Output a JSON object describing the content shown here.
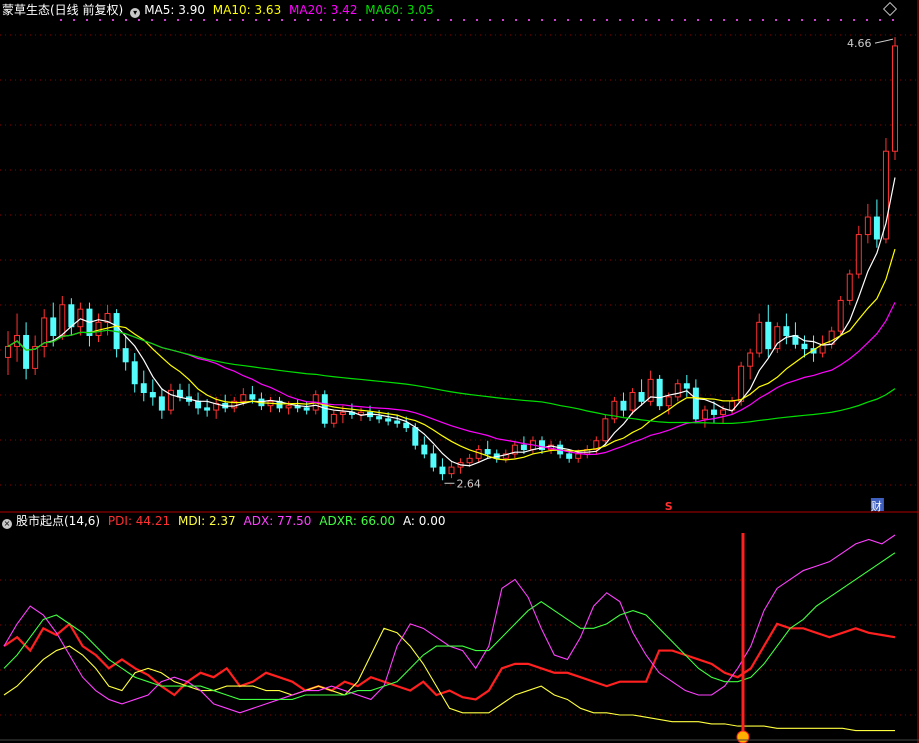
{
  "header": {
    "stock_title": "蒙草生态(日线 前复权)",
    "ma5": "MA5: 3.90",
    "ma10": "MA10: 3.63",
    "ma20": "MA20: 3.42",
    "ma60": "MA60: 3.05"
  },
  "indicator_header": {
    "title": "股市起点(14,6)",
    "pdi": "PDI: 44.21",
    "mdi": "MDI: 2.37",
    "adx": "ADX: 77.50",
    "adxr": "ADXR: 66.00",
    "a": "A: 0.00"
  },
  "colors": {
    "bg": "#000000",
    "up": "#ff3232",
    "down": "#54fcfc",
    "ma5": "#ffffff",
    "ma10": "#ffff00",
    "ma20": "#ff00ff",
    "ma60": "#00e000",
    "pdi": "#ff2020",
    "mdi": "#ffff40",
    "adx": "#ff40ff",
    "adxr": "#40ff40",
    "grid": "#8b0000",
    "frame": "#b00000"
  },
  "chart_data": [
    {
      "type": "candlestick",
      "title": "蒙草生态(日线 前复权)",
      "ylim": [
        2.55,
        4.72
      ],
      "annotations": {
        "high_label": "4.66",
        "low_label": "2.64",
        "marker_s": "S",
        "marker_cai": "财"
      },
      "ohlc": [
        [
          3.2,
          3.32,
          3.12,
          3.25
        ],
        [
          3.25,
          3.4,
          3.18,
          3.3
        ],
        [
          3.3,
          3.36,
          3.1,
          3.15
        ],
        [
          3.15,
          3.3,
          3.12,
          3.25
        ],
        [
          3.25,
          3.42,
          3.2,
          3.38
        ],
        [
          3.38,
          3.45,
          3.25,
          3.3
        ],
        [
          3.3,
          3.48,
          3.28,
          3.44
        ],
        [
          3.44,
          3.47,
          3.3,
          3.34
        ],
        [
          3.34,
          3.45,
          3.3,
          3.42
        ],
        [
          3.42,
          3.45,
          3.25,
          3.3
        ],
        [
          3.3,
          3.4,
          3.27,
          3.36
        ],
        [
          3.36,
          3.44,
          3.3,
          3.4
        ],
        [
          3.4,
          3.42,
          3.2,
          3.24
        ],
        [
          3.24,
          3.3,
          3.14,
          3.18
        ],
        [
          3.18,
          3.22,
          3.04,
          3.08
        ],
        [
          3.08,
          3.14,
          3.0,
          3.04
        ],
        [
          3.04,
          3.1,
          2.98,
          3.02
        ],
        [
          3.02,
          3.06,
          2.92,
          2.96
        ],
        [
          2.96,
          3.08,
          2.94,
          3.05
        ],
        [
          3.05,
          3.08,
          3.0,
          3.02
        ],
        [
          3.02,
          3.08,
          2.98,
          3.0
        ],
        [
          3.0,
          3.04,
          2.94,
          2.97
        ],
        [
          2.97,
          3.01,
          2.93,
          2.96
        ],
        [
          2.96,
          3.02,
          2.92,
          2.99
        ],
        [
          2.99,
          3.03,
          2.95,
          2.97
        ],
        [
          2.97,
          3.02,
          2.95,
          3.0
        ],
        [
          3.0,
          3.06,
          2.98,
          3.03
        ],
        [
          3.03,
          3.07,
          2.99,
          3.01
        ],
        [
          3.01,
          3.04,
          2.96,
          2.98
        ],
        [
          2.98,
          3.02,
          2.95,
          3.0
        ],
        [
          3.0,
          3.02,
          2.95,
          2.97
        ],
        [
          2.97,
          3.0,
          2.94,
          2.98
        ],
        [
          2.98,
          3.01,
          2.95,
          2.97
        ],
        [
          2.97,
          3.0,
          2.94,
          2.96
        ],
        [
          2.96,
          3.05,
          2.94,
          3.03
        ],
        [
          3.03,
          3.05,
          2.88,
          2.9
        ],
        [
          2.9,
          2.96,
          2.88,
          2.94
        ],
        [
          2.94,
          2.98,
          2.9,
          2.95
        ],
        [
          2.95,
          2.99,
          2.92,
          2.94
        ],
        [
          2.94,
          2.97,
          2.91,
          2.95
        ],
        [
          2.95,
          2.98,
          2.91,
          2.93
        ],
        [
          2.93,
          2.96,
          2.9,
          2.92
        ],
        [
          2.92,
          2.95,
          2.89,
          2.91
        ],
        [
          2.91,
          2.94,
          2.88,
          2.9
        ],
        [
          2.9,
          2.93,
          2.86,
          2.88
        ],
        [
          2.88,
          2.9,
          2.78,
          2.8
        ],
        [
          2.8,
          2.84,
          2.74,
          2.76
        ],
        [
          2.76,
          2.8,
          2.68,
          2.7
        ],
        [
          2.7,
          2.74,
          2.64,
          2.67
        ],
        [
          2.67,
          2.73,
          2.65,
          2.7
        ],
        [
          2.7,
          2.74,
          2.67,
          2.72
        ],
        [
          2.72,
          2.76,
          2.7,
          2.74
        ],
        [
          2.74,
          2.8,
          2.72,
          2.78
        ],
        [
          2.78,
          2.82,
          2.74,
          2.76
        ],
        [
          2.76,
          2.78,
          2.72,
          2.74
        ],
        [
          2.74,
          2.78,
          2.72,
          2.76
        ],
        [
          2.76,
          2.82,
          2.74,
          2.8
        ],
        [
          2.8,
          2.84,
          2.76,
          2.78
        ],
        [
          2.78,
          2.84,
          2.76,
          2.82
        ],
        [
          2.82,
          2.84,
          2.76,
          2.78
        ],
        [
          2.78,
          2.82,
          2.76,
          2.8
        ],
        [
          2.8,
          2.82,
          2.74,
          2.76
        ],
        [
          2.76,
          2.78,
          2.72,
          2.74
        ],
        [
          2.74,
          2.78,
          2.72,
          2.76
        ],
        [
          2.76,
          2.8,
          2.74,
          2.78
        ],
        [
          2.78,
          2.84,
          2.76,
          2.82
        ],
        [
          2.82,
          2.94,
          2.8,
          2.92
        ],
        [
          2.92,
          3.02,
          2.9,
          3.0
        ],
        [
          3.0,
          3.04,
          2.93,
          2.96
        ],
        [
          2.96,
          3.06,
          2.94,
          3.04
        ],
        [
          3.04,
          3.1,
          2.98,
          3.0
        ],
        [
          3.0,
          3.14,
          2.98,
          3.1
        ],
        [
          3.1,
          3.12,
          2.96,
          2.98
        ],
        [
          2.98,
          3.04,
          2.94,
          3.02
        ],
        [
          3.02,
          3.1,
          3.0,
          3.08
        ],
        [
          3.08,
          3.12,
          3.02,
          3.06
        ],
        [
          3.06,
          3.1,
          2.9,
          2.92
        ],
        [
          2.92,
          2.98,
          2.88,
          2.96
        ],
        [
          2.96,
          3.0,
          2.9,
          2.94
        ],
        [
          2.94,
          2.98,
          2.9,
          2.96
        ],
        [
          2.96,
          3.02,
          2.94,
          3.0
        ],
        [
          3.0,
          3.18,
          2.98,
          3.16
        ],
        [
          3.16,
          3.24,
          3.1,
          3.22
        ],
        [
          3.22,
          3.4,
          3.2,
          3.36
        ],
        [
          3.36,
          3.44,
          3.2,
          3.24
        ],
        [
          3.24,
          3.36,
          3.22,
          3.34
        ],
        [
          3.34,
          3.4,
          3.26,
          3.3
        ],
        [
          3.3,
          3.36,
          3.24,
          3.26
        ],
        [
          3.26,
          3.3,
          3.2,
          3.24
        ],
        [
          3.24,
          3.3,
          3.18,
          3.22
        ],
        [
          3.22,
          3.3,
          3.2,
          3.26
        ],
        [
          3.26,
          3.34,
          3.24,
          3.32
        ],
        [
          3.32,
          3.48,
          3.3,
          3.46
        ],
        [
          3.46,
          3.6,
          3.44,
          3.58
        ],
        [
          3.58,
          3.8,
          3.56,
          3.76
        ],
        [
          3.76,
          3.9,
          3.72,
          3.84
        ],
        [
          3.84,
          3.92,
          3.7,
          3.74
        ],
        [
          3.74,
          4.2,
          3.72,
          4.14
        ],
        [
          4.14,
          4.66,
          4.1,
          4.62
        ]
      ]
    },
    {
      "type": "line",
      "title": "股市起点(14,6)",
      "ylim": [
        0,
        90
      ],
      "series": [
        {
          "name": "PDI",
          "values": [
            40,
            44,
            38,
            48,
            45,
            50,
            40,
            36,
            30,
            34,
            30,
            27,
            22,
            18,
            24,
            28,
            26,
            30,
            22,
            24,
            28,
            26,
            24,
            20,
            22,
            20,
            24,
            22,
            26,
            24,
            22,
            20,
            24,
            18,
            20,
            17,
            16,
            20,
            30,
            32,
            32,
            30,
            28,
            28,
            26,
            24,
            22,
            24,
            24,
            24,
            38,
            38,
            36,
            34,
            32,
            28,
            26,
            30,
            40,
            50,
            48,
            48,
            46,
            44,
            46,
            48,
            46,
            45,
            44
          ]
        },
        {
          "name": "MDI",
          "values": [
            18,
            22,
            28,
            34,
            38,
            40,
            36,
            30,
            22,
            20,
            28,
            30,
            28,
            24,
            22,
            20,
            20,
            22,
            22,
            22,
            20,
            20,
            18,
            20,
            22,
            20,
            18,
            24,
            36,
            48,
            46,
            40,
            32,
            22,
            12,
            10,
            10,
            10,
            14,
            18,
            20,
            22,
            18,
            16,
            12,
            10,
            10,
            9,
            9,
            8,
            7,
            6,
            6,
            6,
            5,
            5,
            4,
            4,
            4,
            3,
            3,
            3,
            3,
            3,
            3,
            2,
            2,
            2,
            2
          ]
        },
        {
          "name": "ADX",
          "values": [
            40,
            50,
            58,
            54,
            46,
            36,
            26,
            20,
            16,
            14,
            16,
            18,
            24,
            26,
            24,
            20,
            14,
            12,
            10,
            12,
            14,
            16,
            18,
            20,
            20,
            22,
            20,
            18,
            16,
            22,
            40,
            50,
            48,
            44,
            40,
            38,
            30,
            40,
            66,
            70,
            62,
            48,
            36,
            34,
            44,
            58,
            64,
            60,
            46,
            36,
            28,
            24,
            20,
            18,
            18,
            22,
            30,
            40,
            56,
            66,
            70,
            74,
            76,
            78,
            82,
            86,
            88,
            86,
            90
          ]
        },
        {
          "name": "ADXR",
          "values": [
            30,
            36,
            44,
            52,
            54,
            50,
            46,
            40,
            34,
            30,
            26,
            24,
            22,
            22,
            22,
            22,
            20,
            18,
            16,
            16,
            16,
            16,
            16,
            18,
            18,
            18,
            18,
            20,
            20,
            22,
            24,
            30,
            36,
            40,
            40,
            40,
            38,
            38,
            44,
            50,
            56,
            60,
            56,
            52,
            48,
            48,
            50,
            54,
            56,
            54,
            48,
            42,
            36,
            30,
            26,
            24,
            24,
            26,
            32,
            40,
            48,
            52,
            58,
            62,
            66,
            70,
            74,
            78,
            82
          ]
        }
      ]
    }
  ]
}
